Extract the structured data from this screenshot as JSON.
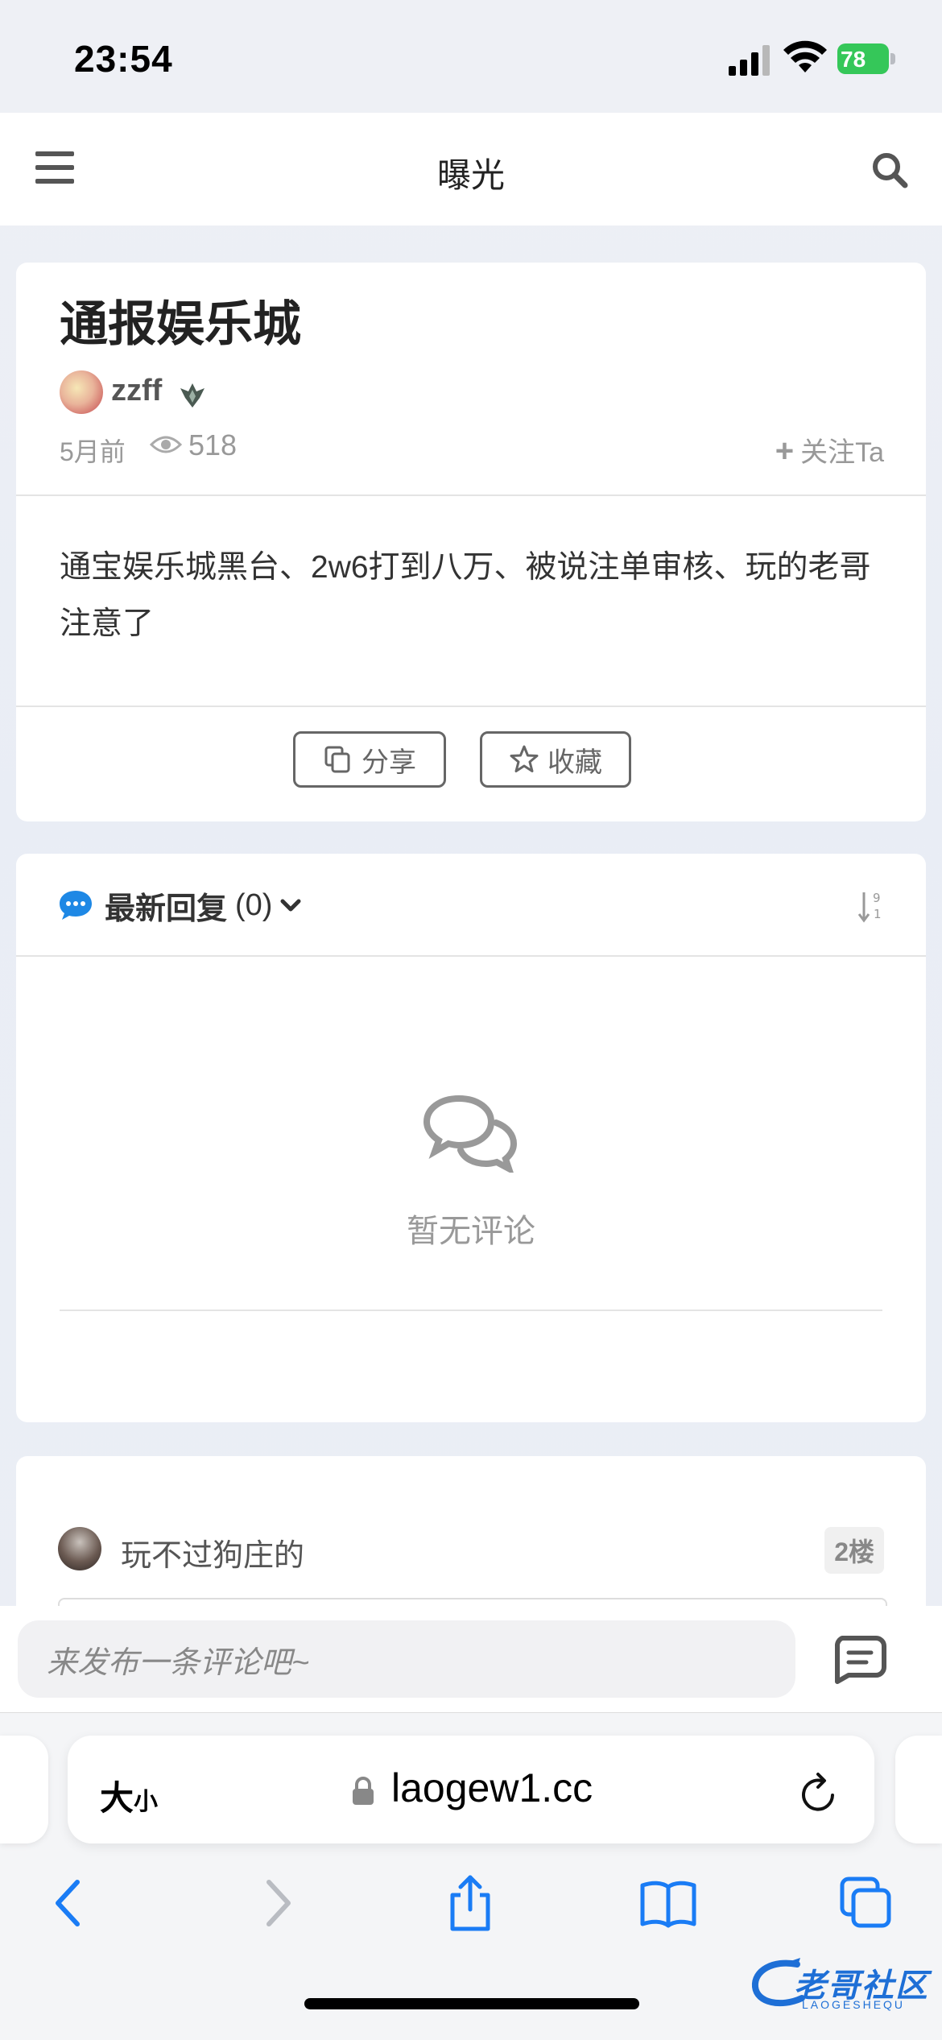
{
  "status_bar": {
    "time": "23:54",
    "battery": "78"
  },
  "header": {
    "title": "曝光"
  },
  "post": {
    "title": "通报娱乐城",
    "author": "zzff",
    "time_ago": "5月前",
    "views": "518",
    "follow_label": "关注Ta",
    "body": "通宝娱乐城黑台、2w6打到八万、被说注单审核、玩的老哥注意了",
    "share_label": "分享",
    "favorite_label": "收藏"
  },
  "replies": {
    "title": "最新回复",
    "count": "(0)",
    "empty_text": "暂无评论"
  },
  "comment": {
    "user": "玩不过狗庄的",
    "floor": "2楼"
  },
  "comment_bar": {
    "placeholder": "来发布一条评论吧~"
  },
  "browser": {
    "font_size_big": "大",
    "font_size_small": "小",
    "url": "laogew1.cc"
  },
  "watermark": {
    "text": "老哥社区",
    "sub": "LAOGESHEQU"
  },
  "colors": {
    "accent": "#1e88e5",
    "battery": "#35c759"
  }
}
